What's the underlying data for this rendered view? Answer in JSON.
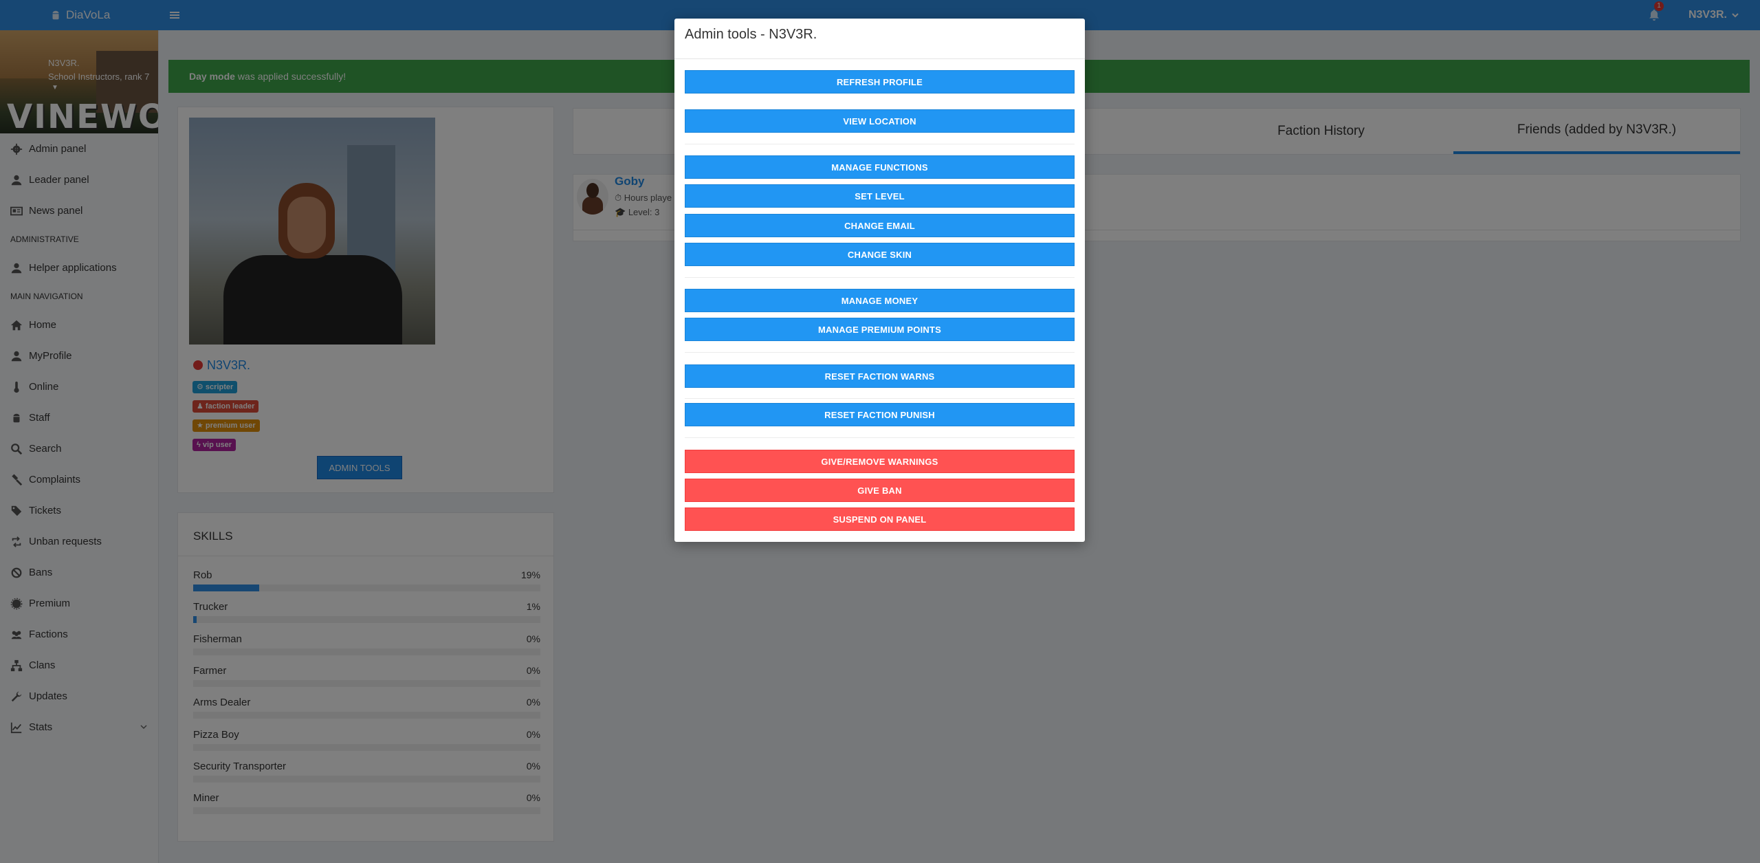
{
  "navbar": {
    "brand": "DiaVoLa",
    "notification_count": "1",
    "user_label": "N3V3R."
  },
  "sidebar": {
    "user_name": "N3V3R.",
    "user_rank": "School Instructors, rank 7",
    "banner_text": "VINEWOO",
    "menu": [
      {
        "label": "Admin panel",
        "icon": "gear-icon"
      },
      {
        "label": "Leader panel",
        "icon": "user-icon"
      },
      {
        "label": "News panel",
        "icon": "newspaper-icon"
      },
      {
        "header": "ADMINISTRATIVE"
      },
      {
        "label": "Helper applications",
        "icon": "user-icon"
      },
      {
        "header": "MAIN NAVIGATION"
      },
      {
        "label": "Home",
        "icon": "home-icon"
      },
      {
        "label": "MyProfile",
        "icon": "user-icon"
      },
      {
        "label": "Online",
        "icon": "thermometer-icon"
      },
      {
        "label": "Staff",
        "icon": "android-icon"
      },
      {
        "label": "Search",
        "icon": "search-icon"
      },
      {
        "label": "Complaints",
        "icon": "gavel-icon"
      },
      {
        "label": "Tickets",
        "icon": "tags-icon"
      },
      {
        "label": "Unban requests",
        "icon": "retweet-icon"
      },
      {
        "label": "Bans",
        "icon": "ban-icon"
      },
      {
        "label": "Premium",
        "icon": "certificate-icon"
      },
      {
        "label": "Factions",
        "icon": "users-icon"
      },
      {
        "label": "Clans",
        "icon": "sitemap-icon"
      },
      {
        "label": "Updates",
        "icon": "wrench-icon"
      },
      {
        "label": "Stats",
        "icon": "chart-line-icon"
      }
    ]
  },
  "alert": {
    "bold": "Day mode",
    "text": "was applied successfully!"
  },
  "profile": {
    "name": "N3V3R.",
    "status_color": "#e53935",
    "tags": [
      "scripter",
      "faction leader",
      "premium user",
      "vip user"
    ],
    "admin_tools_label": "ADMIN TOOLS"
  },
  "skills": {
    "title": "SKILLS",
    "items": [
      {
        "name": "Rob",
        "pct": "19%",
        "value": 19
      },
      {
        "name": "Trucker",
        "pct": "1%",
        "value": 1
      },
      {
        "name": "Fisherman",
        "pct": "0%",
        "value": 0
      },
      {
        "name": "Farmer",
        "pct": "0%",
        "value": 0
      },
      {
        "name": "Arms Dealer",
        "pct": "0%",
        "value": 0
      },
      {
        "name": "Pizza Boy",
        "pct": "0%",
        "value": 0
      },
      {
        "name": "Security Transporter",
        "pct": "0%",
        "value": 0
      },
      {
        "name": "Miner",
        "pct": "0%",
        "value": 0
      }
    ]
  },
  "tabs": {
    "faction_history": "Faction History",
    "friends": "Friends (added by N3V3R.)"
  },
  "friend": {
    "name": "Goby",
    "hours": "Hours playe",
    "level": "Level: 3"
  },
  "modal": {
    "title": "Admin tools - N3V3R.",
    "buttons": {
      "refresh_profile": "REFRESH PROFILE",
      "view_location": "VIEW LOCATION",
      "manage_functions": "MANAGE FUNCTIONS",
      "set_level": "SET LEVEL",
      "change_email": "CHANGE EMAIL",
      "change_skin": "CHANGE SKIN",
      "manage_money": "MANAGE MONEY",
      "manage_premium_points": "MANAGE PREMIUM POINTS",
      "reset_faction_warns": "RESET FACTION WARNS",
      "reset_faction_punish": "RESET FACTION PUNISH",
      "give_remove_warnings": "GIVE/REMOVE WARNINGS",
      "give_ban": "GIVE BAN",
      "suspend_on_panel": "SUSPEND ON PANEL"
    }
  },
  "colors": {
    "navbar": "#2e8fe6",
    "modal_blue": "#2196f3",
    "modal_red": "#ff5252",
    "success": "#3fa64a"
  }
}
